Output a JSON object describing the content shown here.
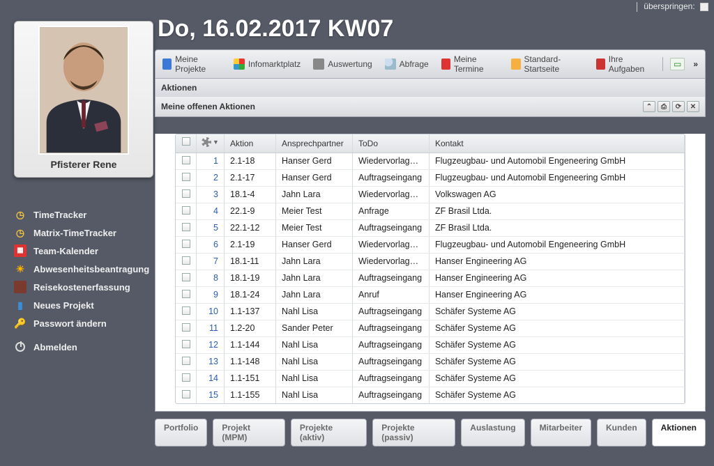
{
  "skip": {
    "label": "überspringen:"
  },
  "profile": {
    "name": "Pfisterer Rene"
  },
  "nav": {
    "items": [
      {
        "id": "timetracker",
        "label": "TimeTracker"
      },
      {
        "id": "matrix-timetracker",
        "label": "Matrix-TimeTracker"
      },
      {
        "id": "team-kalender",
        "label": "Team-Kalender"
      },
      {
        "id": "abwesenheit",
        "label": "Abwesenheitsbeantragung"
      },
      {
        "id": "reisekosten",
        "label": "Reisekostenerfassung"
      },
      {
        "id": "neues-projekt",
        "label": "Neues Projekt"
      },
      {
        "id": "passwort",
        "label": "Passwort ändern"
      },
      {
        "id": "abmelden",
        "label": "Abmelden"
      }
    ]
  },
  "header": {
    "title": "Do, 16.02.2017 KW07"
  },
  "toolbar": {
    "items": [
      {
        "id": "meine-projekte",
        "label": "Meine Projekte"
      },
      {
        "id": "infomarktplatz",
        "label": "Infomarktplatz"
      },
      {
        "id": "auswertung",
        "label": "Auswertung"
      },
      {
        "id": "abfrage",
        "label": "Abfrage"
      },
      {
        "id": "meine-termine",
        "label": "Meine Termine"
      },
      {
        "id": "standard-startseite",
        "label": "Standard-Startseite"
      },
      {
        "id": "ihre-aufgaben",
        "label": "Ihre Aufgaben"
      }
    ],
    "overflow": "»"
  },
  "section": {
    "title": "Aktionen"
  },
  "panel": {
    "title": "Meine offenen Aktionen"
  },
  "grid": {
    "columns": {
      "aktion": "Aktion",
      "ansprechpartner": "Ansprechpartner",
      "todo": "ToDo",
      "kontakt": "Kontakt"
    },
    "rows": [
      {
        "n": "1",
        "aktion": "2.1-18",
        "ap": "Hanser Gerd",
        "todo": "Wiedervorlage …",
        "kontakt": "Flugzeugbau- und Automobil Engeneering GmbH"
      },
      {
        "n": "2",
        "aktion": "2.1-17",
        "ap": "Hanser Gerd",
        "todo": "Auftragseingang",
        "kontakt": "Flugzeugbau- und Automobil Engeneering GmbH"
      },
      {
        "n": "3",
        "aktion": "18.1-4",
        "ap": "Jahn Lara",
        "todo": "Wiedervorlage …",
        "kontakt": "Volkswagen AG"
      },
      {
        "n": "4",
        "aktion": "22.1-9",
        "ap": "Meier Test",
        "todo": "Anfrage",
        "kontakt": "ZF Brasil Ltda."
      },
      {
        "n": "5",
        "aktion": "22.1-12",
        "ap": "Meier Test",
        "todo": "Auftragseingang",
        "kontakt": "ZF Brasil Ltda."
      },
      {
        "n": "6",
        "aktion": "2.1-19",
        "ap": "Hanser Gerd",
        "todo": "Wiedervorlage …",
        "kontakt": "Flugzeugbau- und Automobil Engeneering GmbH"
      },
      {
        "n": "7",
        "aktion": "18.1-11",
        "ap": "Jahn Lara",
        "todo": "Wiedervorlage …",
        "kontakt": "Hanser Engineering AG"
      },
      {
        "n": "8",
        "aktion": "18.1-19",
        "ap": "Jahn Lara",
        "todo": "Auftragseingang",
        "kontakt": "Hanser Engineering AG"
      },
      {
        "n": "9",
        "aktion": "18.1-24",
        "ap": "Jahn Lara",
        "todo": "Anruf",
        "kontakt": "Hanser Engineering AG"
      },
      {
        "n": "10",
        "aktion": "1.1-137",
        "ap": "Nahl Lisa",
        "todo": "Auftragseingang",
        "kontakt": "Schäfer Systeme AG"
      },
      {
        "n": "11",
        "aktion": "1.2-20",
        "ap": "Sander Peter",
        "todo": "Auftragseingang",
        "kontakt": "Schäfer Systeme AG"
      },
      {
        "n": "12",
        "aktion": "1.1-144",
        "ap": "Nahl Lisa",
        "todo": "Auftragseingang",
        "kontakt": "Schäfer Systeme AG"
      },
      {
        "n": "13",
        "aktion": "1.1-148",
        "ap": "Nahl Lisa",
        "todo": "Auftragseingang",
        "kontakt": "Schäfer Systeme AG"
      },
      {
        "n": "14",
        "aktion": "1.1-151",
        "ap": "Nahl Lisa",
        "todo": "Auftragseingang",
        "kontakt": "Schäfer Systeme AG"
      },
      {
        "n": "15",
        "aktion": "1.1-155",
        "ap": "Nahl Lisa",
        "todo": "Auftragseingang",
        "kontakt": "Schäfer Systeme AG"
      }
    ]
  },
  "bottom_tabs": {
    "items": [
      {
        "id": "portfolio",
        "label": "Portfolio"
      },
      {
        "id": "projekt-mpm",
        "label": "Projekt (MPM)"
      },
      {
        "id": "projekte-aktiv",
        "label": "Projekte (aktiv)"
      },
      {
        "id": "projekte-passiv",
        "label": "Projekte (passiv)"
      },
      {
        "id": "auslastung",
        "label": "Auslastung"
      },
      {
        "id": "mitarbeiter",
        "label": "Mitarbeiter"
      },
      {
        "id": "kunden",
        "label": "Kunden"
      },
      {
        "id": "aktionen",
        "label": "Aktionen",
        "active": true
      }
    ]
  }
}
